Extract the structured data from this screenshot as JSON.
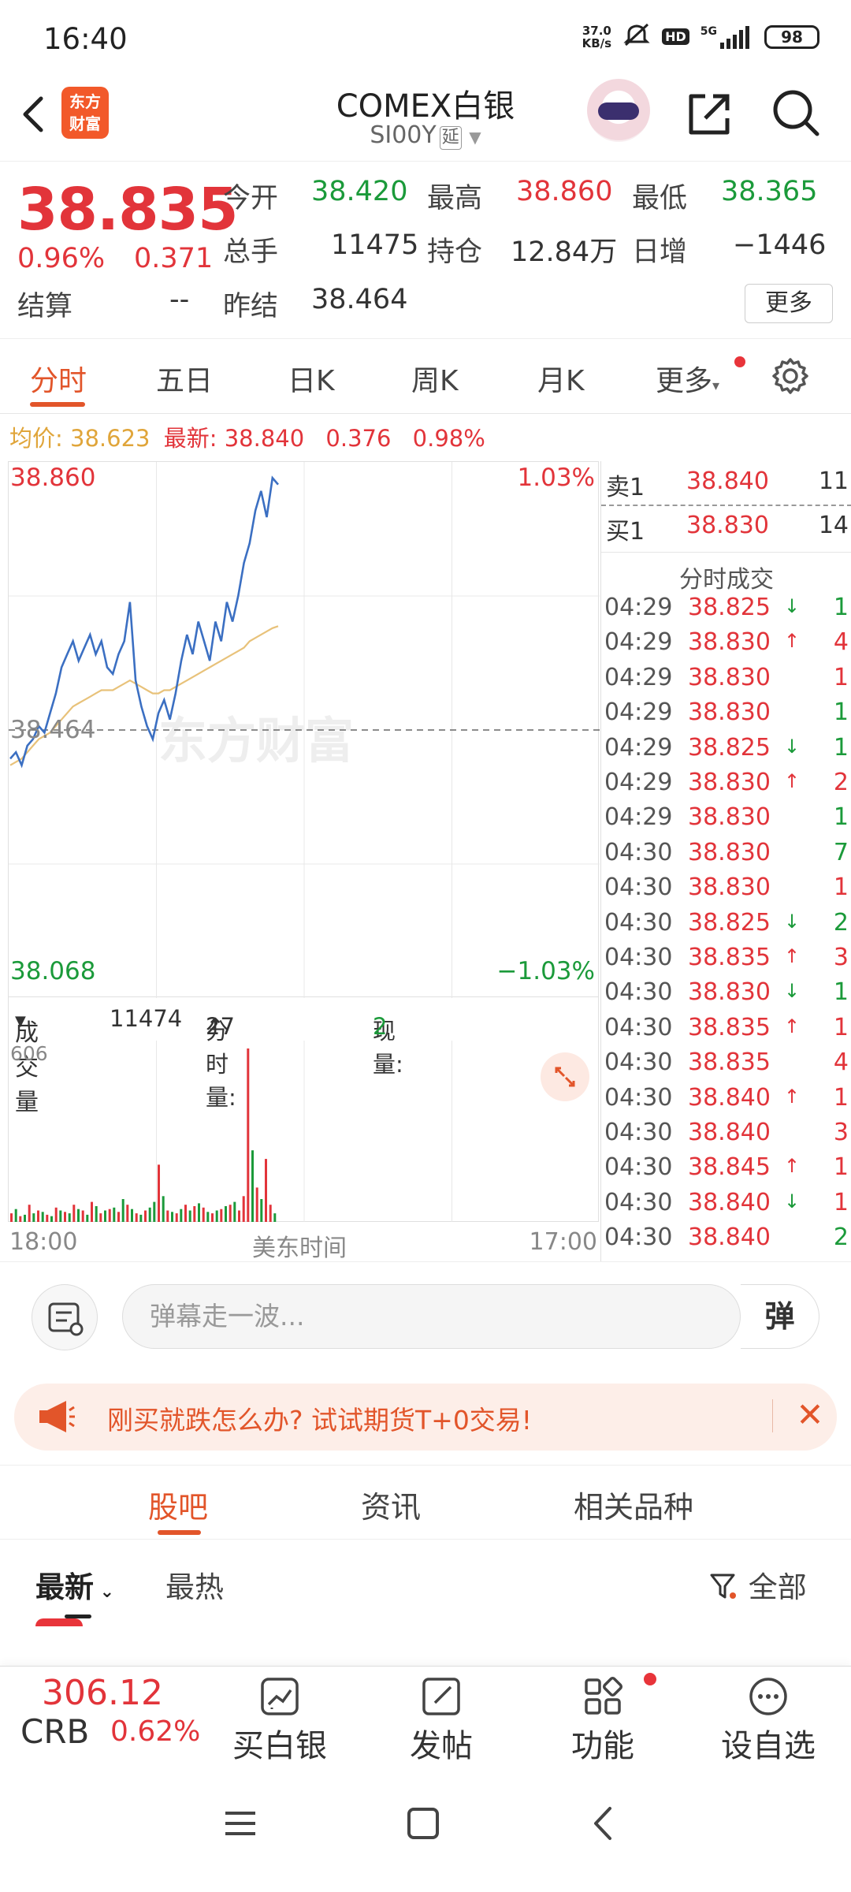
{
  "status": {
    "time": "16:40",
    "net_speed_value": "37.0",
    "net_speed_unit": "KB/s",
    "hd": "HD",
    "signal": "5G",
    "battery": "98"
  },
  "header": {
    "logo_line1": "东方",
    "logo_line2": "财富",
    "title": "COMEX白银",
    "code": "SI00Y",
    "delay_tag": "延"
  },
  "quote": {
    "price": "38.835",
    "change_pct": "0.96%",
    "change_val": "0.371",
    "open_label": "今开",
    "open": "38.420",
    "high_label": "最高",
    "high": "38.860",
    "low_label": "最低",
    "low": "38.365",
    "volume_label": "总手",
    "volume": "11475",
    "position_label": "持仓",
    "position": "12.84万",
    "daily_inc_label": "日增",
    "daily_inc": "−1446",
    "settle_label": "结算",
    "settle": "--",
    "prev_settle_label": "昨结",
    "prev_settle": "38.464",
    "more_label": "更多"
  },
  "tabs": [
    "分时",
    "五日",
    "日K",
    "周K",
    "月K",
    "更多"
  ],
  "info_line": {
    "avg_label": "均价: ",
    "avg": "38.623",
    "latest_label": "最新: ",
    "latest": "38.840",
    "change": "0.376",
    "pct": "0.98%"
  },
  "chart": {
    "y_top": "38.860",
    "y_top_pct": "1.03%",
    "y_mid": "38.464",
    "y_bottom": "38.068",
    "y_bottom_pct": "−1.03%",
    "watermark": "东方财富",
    "x_start": "18:00",
    "x_mid": "美东时间",
    "x_end": "17:00"
  },
  "chart_data": {
    "type": "line",
    "title": "",
    "ylim": [
      38.068,
      38.86
    ],
    "reference": 38.464,
    "series": [
      {
        "name": "",
        "values": [
          38.42,
          38.43,
          38.41,
          38.44,
          38.45,
          38.47,
          38.46,
          38.49,
          38.52,
          38.56,
          38.58,
          38.6,
          38.57,
          38.59,
          38.61,
          38.58,
          38.6,
          38.56,
          38.55,
          38.58,
          38.6,
          38.66,
          38.54,
          38.5,
          38.47,
          38.45,
          38.49,
          38.51,
          38.48,
          38.52,
          38.57,
          38.61,
          38.58,
          38.63,
          38.6,
          38.57,
          38.63,
          38.6,
          38.66,
          38.63,
          38.67,
          38.72,
          38.75,
          38.8,
          38.83,
          38.79,
          38.85,
          38.84
        ]
      },
      {
        "name": "",
        "values": [
          38.41,
          38.415,
          38.42,
          38.43,
          38.44,
          38.45,
          38.455,
          38.46,
          38.47,
          38.48,
          38.49,
          38.5,
          38.505,
          38.51,
          38.515,
          38.52,
          38.525,
          38.525,
          38.525,
          38.53,
          38.535,
          38.54,
          38.535,
          38.53,
          38.525,
          38.52,
          38.52,
          38.525,
          38.525,
          38.53,
          38.535,
          38.54,
          38.545,
          38.55,
          38.555,
          38.56,
          38.565,
          38.57,
          38.575,
          38.58,
          38.585,
          38.59,
          38.6,
          38.605,
          38.61,
          38.615,
          38.62,
          38.623
        ]
      }
    ]
  },
  "volume": {
    "label": "成交量",
    "total": "11474",
    "period_label": "分时量:",
    "period_val": "27",
    "current_label": "现量:",
    "current_val": "2",
    "max": "606",
    "bars": [
      30,
      45,
      20,
      25,
      60,
      30,
      40,
      35,
      25,
      20,
      50,
      40,
      35,
      30,
      60,
      45,
      40,
      25,
      70,
      55,
      30,
      40,
      45,
      50,
      35,
      80,
      60,
      45,
      30,
      25,
      40,
      50,
      70,
      200,
      90,
      40,
      35,
      30,
      45,
      60,
      40,
      55,
      65,
      50,
      35,
      30,
      40,
      45,
      55,
      60,
      70,
      40,
      90,
      606,
      250,
      120,
      80,
      220,
      60,
      30
    ],
    "colors": [
      "r",
      "g",
      "r",
      "g",
      "r",
      "g",
      "r",
      "g",
      "r",
      "g",
      "r",
      "g",
      "r",
      "g",
      "r",
      "g",
      "r",
      "g",
      "r",
      "g",
      "r",
      "g",
      "r",
      "g",
      "r",
      "g",
      "r",
      "g",
      "r",
      "g",
      "r",
      "g",
      "g",
      "r",
      "g",
      "r",
      "g",
      "r",
      "g",
      "r",
      "g",
      "r",
      "g",
      "r",
      "g",
      "r",
      "g",
      "r",
      "g",
      "r",
      "g",
      "r",
      "r",
      "r",
      "g",
      "r",
      "g",
      "r",
      "r",
      "g"
    ]
  },
  "order_book": {
    "ask_label": "卖1",
    "ask_price": "38.840",
    "ask_vol": "11",
    "bid_label": "买1",
    "bid_price": "38.830",
    "bid_vol": "14",
    "trades_title": "分时成交",
    "trades": [
      {
        "time": "04:29",
        "price": "38.825",
        "dir": "down",
        "vol": "1",
        "vcolor": "green"
      },
      {
        "time": "04:29",
        "price": "38.830",
        "dir": "up",
        "vol": "4",
        "vcolor": "red"
      },
      {
        "time": "04:29",
        "price": "38.830",
        "dir": "",
        "vol": "1",
        "vcolor": "red"
      },
      {
        "time": "04:29",
        "price": "38.830",
        "dir": "",
        "vol": "1",
        "vcolor": "green"
      },
      {
        "time": "04:29",
        "price": "38.825",
        "dir": "down",
        "vol": "1",
        "vcolor": "green"
      },
      {
        "time": "04:29",
        "price": "38.830",
        "dir": "up",
        "vol": "2",
        "vcolor": "red"
      },
      {
        "time": "04:29",
        "price": "38.830",
        "dir": "",
        "vol": "1",
        "vcolor": "green"
      },
      {
        "time": "04:30",
        "price": "38.830",
        "dir": "",
        "vol": "7",
        "vcolor": "green"
      },
      {
        "time": "04:30",
        "price": "38.830",
        "dir": "",
        "vol": "1",
        "vcolor": "red"
      },
      {
        "time": "04:30",
        "price": "38.825",
        "dir": "down",
        "vol": "2",
        "vcolor": "green"
      },
      {
        "time": "04:30",
        "price": "38.835",
        "dir": "up",
        "vol": "3",
        "vcolor": "red"
      },
      {
        "time": "04:30",
        "price": "38.830",
        "dir": "down",
        "vol": "1",
        "vcolor": "green"
      },
      {
        "time": "04:30",
        "price": "38.835",
        "dir": "up",
        "vol": "1",
        "vcolor": "red"
      },
      {
        "time": "04:30",
        "price": "38.835",
        "dir": "",
        "vol": "4",
        "vcolor": "red"
      },
      {
        "time": "04:30",
        "price": "38.840",
        "dir": "up",
        "vol": "1",
        "vcolor": "red"
      },
      {
        "time": "04:30",
        "price": "38.840",
        "dir": "",
        "vol": "3",
        "vcolor": "red"
      },
      {
        "time": "04:30",
        "price": "38.845",
        "dir": "up",
        "vol": "1",
        "vcolor": "red"
      },
      {
        "time": "04:30",
        "price": "38.840",
        "dir": "down",
        "vol": "1",
        "vcolor": "red"
      },
      {
        "time": "04:30",
        "price": "38.840",
        "dir": "",
        "vol": "2",
        "vcolor": "green"
      }
    ]
  },
  "danmu": {
    "placeholder": "弹幕走一波...",
    "toggle": "弹"
  },
  "promo": {
    "text": "刚买就跌怎么办? 试试期货T+0交易!"
  },
  "section_tabs": [
    "股吧",
    "资讯",
    "相关品种"
  ],
  "feed": {
    "latest": "最新",
    "hot": "最热",
    "filter": "全部"
  },
  "bottom_bar": {
    "crb_price": "306.12",
    "crb_label": "CRB",
    "crb_pct": "0.62%",
    "buy": "买白银",
    "post": "发帖",
    "functions": "功能",
    "watchlist": "设自选"
  },
  "colors": {
    "up": "#e2343a",
    "down": "#1b9a3a",
    "accent": "#e2552a",
    "price_line": "#3b6fc2",
    "avg_line": "#e8c27a"
  }
}
